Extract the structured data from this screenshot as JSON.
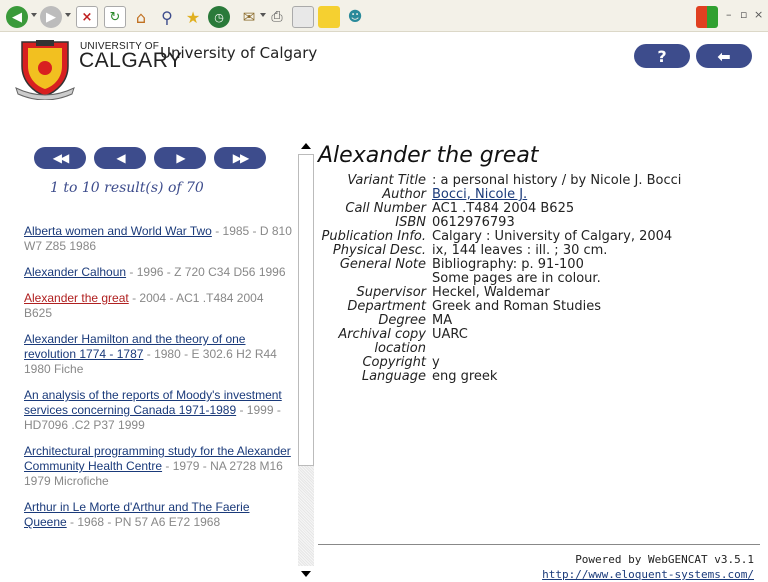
{
  "toolbar": {
    "icons": [
      "back-icon",
      "forward-icon",
      "stop-icon",
      "refresh-icon",
      "home-icon",
      "search-icon",
      "favorites-icon",
      "history-icon",
      "mail-icon",
      "print-icon",
      "edit-icon",
      "notes-icon",
      "messenger-icon",
      "windows-flag-icon"
    ],
    "window_controls": [
      "–",
      "▫",
      "×"
    ]
  },
  "header": {
    "logo_line1": "UNIVERSITY OF",
    "logo_line2": "CALGARY",
    "site_title": "University of Calgary",
    "help_label": "?",
    "back_label": "⬅"
  },
  "nav": {
    "first": "◀◀",
    "prev": "◀",
    "next": "▶",
    "last": "▶▶",
    "results_text": "1 to 10 result(s) of 70"
  },
  "results": [
    {
      "title": "Alberta women and World War Two",
      "detail": " - 1985 - D 810 W7 Z85 1986",
      "current": false
    },
    {
      "title": "Alexander Calhoun",
      "detail": " - 1996 - Z 720 C34 D56 1996",
      "current": false
    },
    {
      "title": "Alexander the great",
      "detail": " - 2004 - AC1 .T484 2004 B625",
      "current": true
    },
    {
      "title": "Alexander Hamilton and the theory of one revolution 1774 - 1787",
      "detail": " - 1980 - E 302.6 H2 R44 1980 Fiche",
      "current": false
    },
    {
      "title": "An analysis of the reports of Moody's investment services concerning Canada 1971-1989",
      "detail": " - 1999 - HD7096 .C2 P37 1999",
      "current": false
    },
    {
      "title": "Architectural programming study for the Alexander Community Health Centre",
      "detail": " - 1979 - NA 2728 M16 1979 Microfiche",
      "current": false
    },
    {
      "title": "Arthur in Le Morte d'Arthur and The Faerie Queene",
      "detail": " - 1968 - PN 57 A6 E72 1968",
      "current": false
    }
  ],
  "record": {
    "title": "Alexander the great",
    "fields": [
      {
        "label": "Variant Title",
        "value": ": a personal history / by Nicole J. Bocci",
        "link": false
      },
      {
        "label": "Author",
        "value": "Bocci, Nicole J.",
        "link": true
      },
      {
        "label": "Call Number",
        "value": "AC1 .T484 2004 B625",
        "link": false
      },
      {
        "label": "ISBN",
        "value": "0612976793",
        "link": false
      },
      {
        "label": "Publication Info.",
        "value": "Calgary : University of Calgary, 2004",
        "link": false
      },
      {
        "label": "Physical Desc.",
        "value": "ix, 144 leaves : ill. ; 30 cm.",
        "link": false
      },
      {
        "label": "General Note",
        "value": "Bibliography: p. 91-100",
        "link": false
      },
      {
        "label": "",
        "value": "Some pages are in colour.",
        "link": false
      },
      {
        "label": "Supervisor",
        "value": "Heckel, Waldemar",
        "link": false
      },
      {
        "label": "Department",
        "value": "Greek and Roman Studies",
        "link": false
      },
      {
        "label": "Degree",
        "value": "MA",
        "link": false
      },
      {
        "label": "Archival copy location",
        "value": "UARC",
        "link": false
      },
      {
        "label": "Copyright",
        "value": "y",
        "link": false
      },
      {
        "label": "Language",
        "value": "eng greek",
        "link": false
      }
    ]
  },
  "footer": {
    "powered_by": "Powered by WebGENCAT v3.5.1",
    "link": "http://www.eloquent-systems.com/"
  },
  "colors": {
    "accent": "#3d4c8c",
    "link": "#1a3a7a",
    "current_link": "#b02020"
  }
}
